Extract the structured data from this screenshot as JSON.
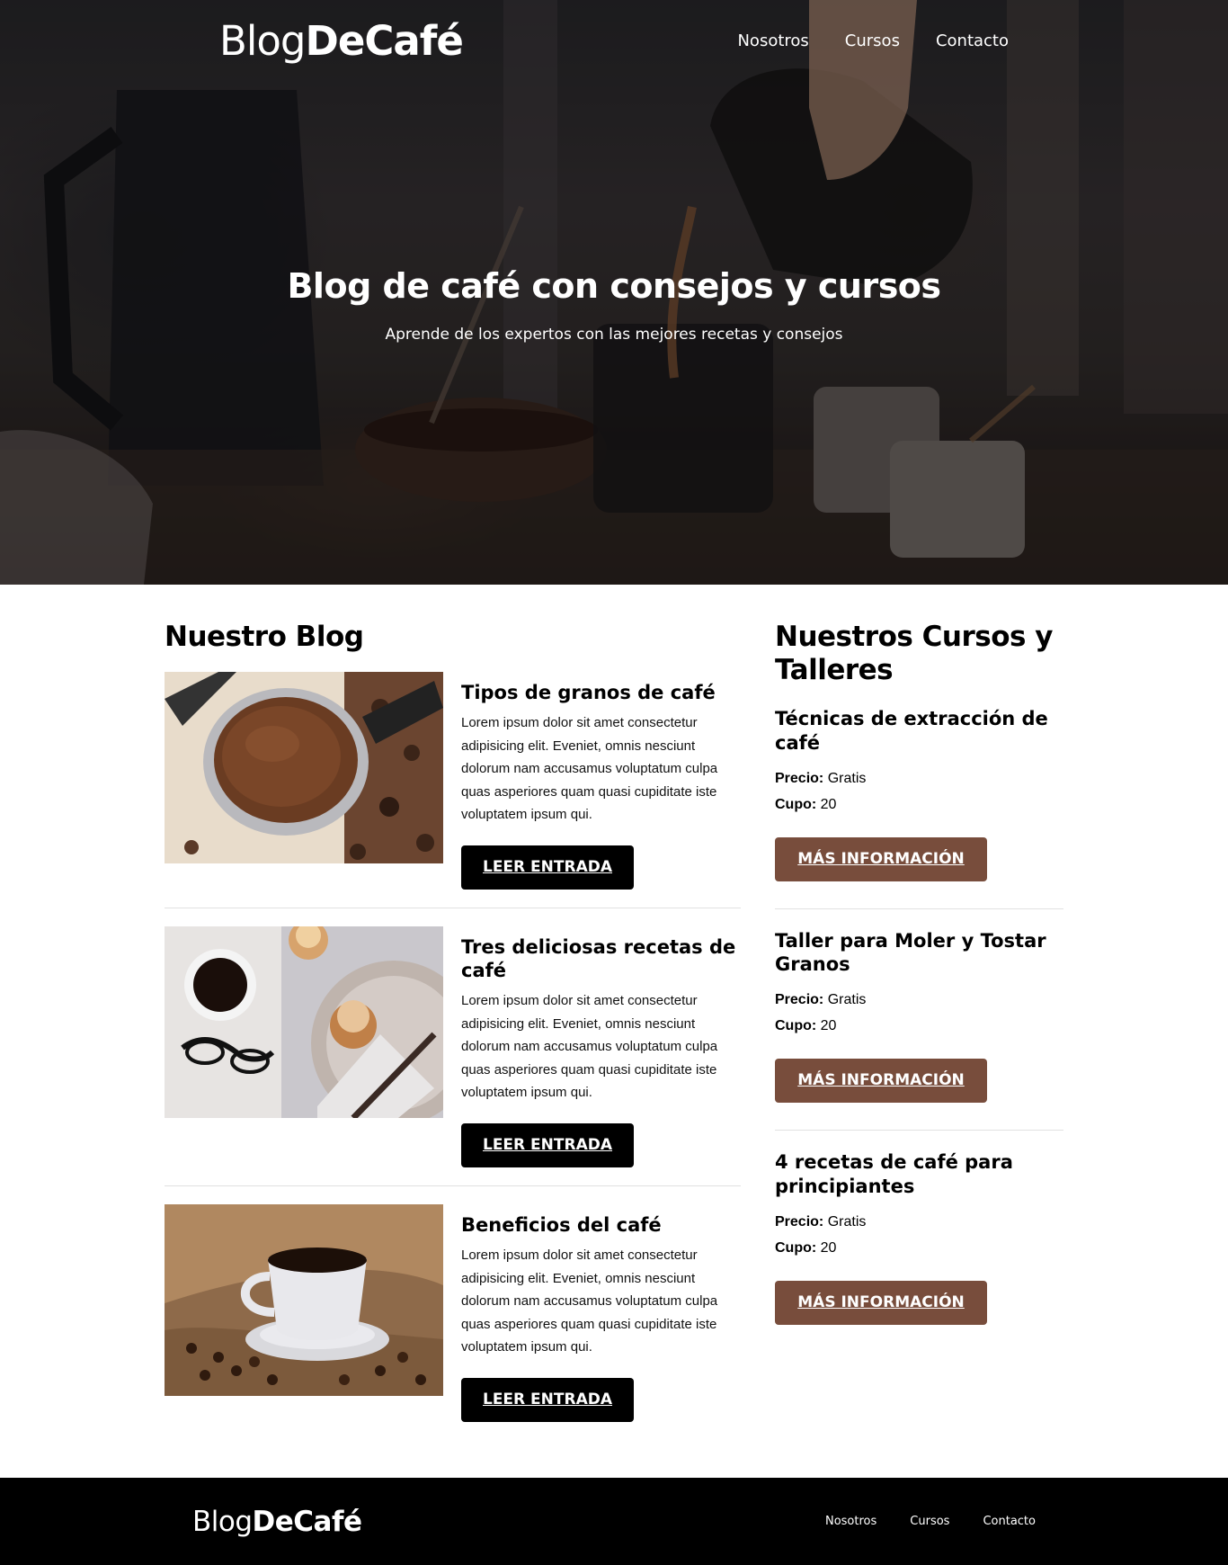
{
  "site": {
    "logo_light": "Blog",
    "logo_bold": "DeCafé"
  },
  "nav": {
    "items": [
      "Nosotros",
      "Cursos",
      "Contacto"
    ]
  },
  "hero": {
    "title": "Blog de café con consejos y cursos",
    "subtitle": "Aprende de los expertos con las mejores recetas y consejos"
  },
  "blog": {
    "heading": "Nuestro Blog",
    "posts": [
      {
        "title": "Tipos de granos de café",
        "text": "Lorem ipsum dolor sit amet consectetur adipisicing elit. Eveniet, omnis nesciunt dolorum nam accusamus voluptatum culpa quas asperiores quam quasi cupiditate iste voluptatem ipsum qui.",
        "button": "Leer Entrada"
      },
      {
        "title": "Tres deliciosas recetas de café",
        "text": "Lorem ipsum dolor sit amet consectetur adipisicing elit. Eveniet, omnis nesciunt dolorum nam accusamus voluptatum culpa quas asperiores quam quasi cupiditate iste voluptatem ipsum qui.",
        "button": "Leer Entrada"
      },
      {
        "title": "Beneficios del café",
        "text": "Lorem ipsum dolor sit amet consectetur adipisicing elit. Eveniet, omnis nesciunt dolorum nam accusamus voluptatum culpa quas asperiores quam quasi cupiditate iste voluptatem ipsum qui.",
        "button": "Leer Entrada"
      }
    ]
  },
  "courses": {
    "heading": "Nuestros Cursos y Talleres",
    "price_label": "Precio:",
    "quota_label": "Cupo:",
    "items": [
      {
        "title": "Técnicas de extracción de café",
        "price": "Gratis",
        "quota": "20",
        "button": "MÁS INFORMACIÓN"
      },
      {
        "title": "Taller para Moler y Tostar Granos",
        "price": "Gratis",
        "quota": "20",
        "button": "MÁS INFORMACIÓN"
      },
      {
        "title": "4 recetas de café para principiantes",
        "price": "Gratis",
        "quota": "20",
        "button": "MÁS INFORMACIÓN"
      }
    ]
  },
  "footer": {
    "logo_light": "Blog",
    "logo_bold": "DeCafé",
    "nav": [
      "Nosotros",
      "Cursos",
      "Contacto"
    ]
  },
  "colors": {
    "brown_button": "#784d3c",
    "black_button": "#000000",
    "footer_bg": "#000000"
  }
}
